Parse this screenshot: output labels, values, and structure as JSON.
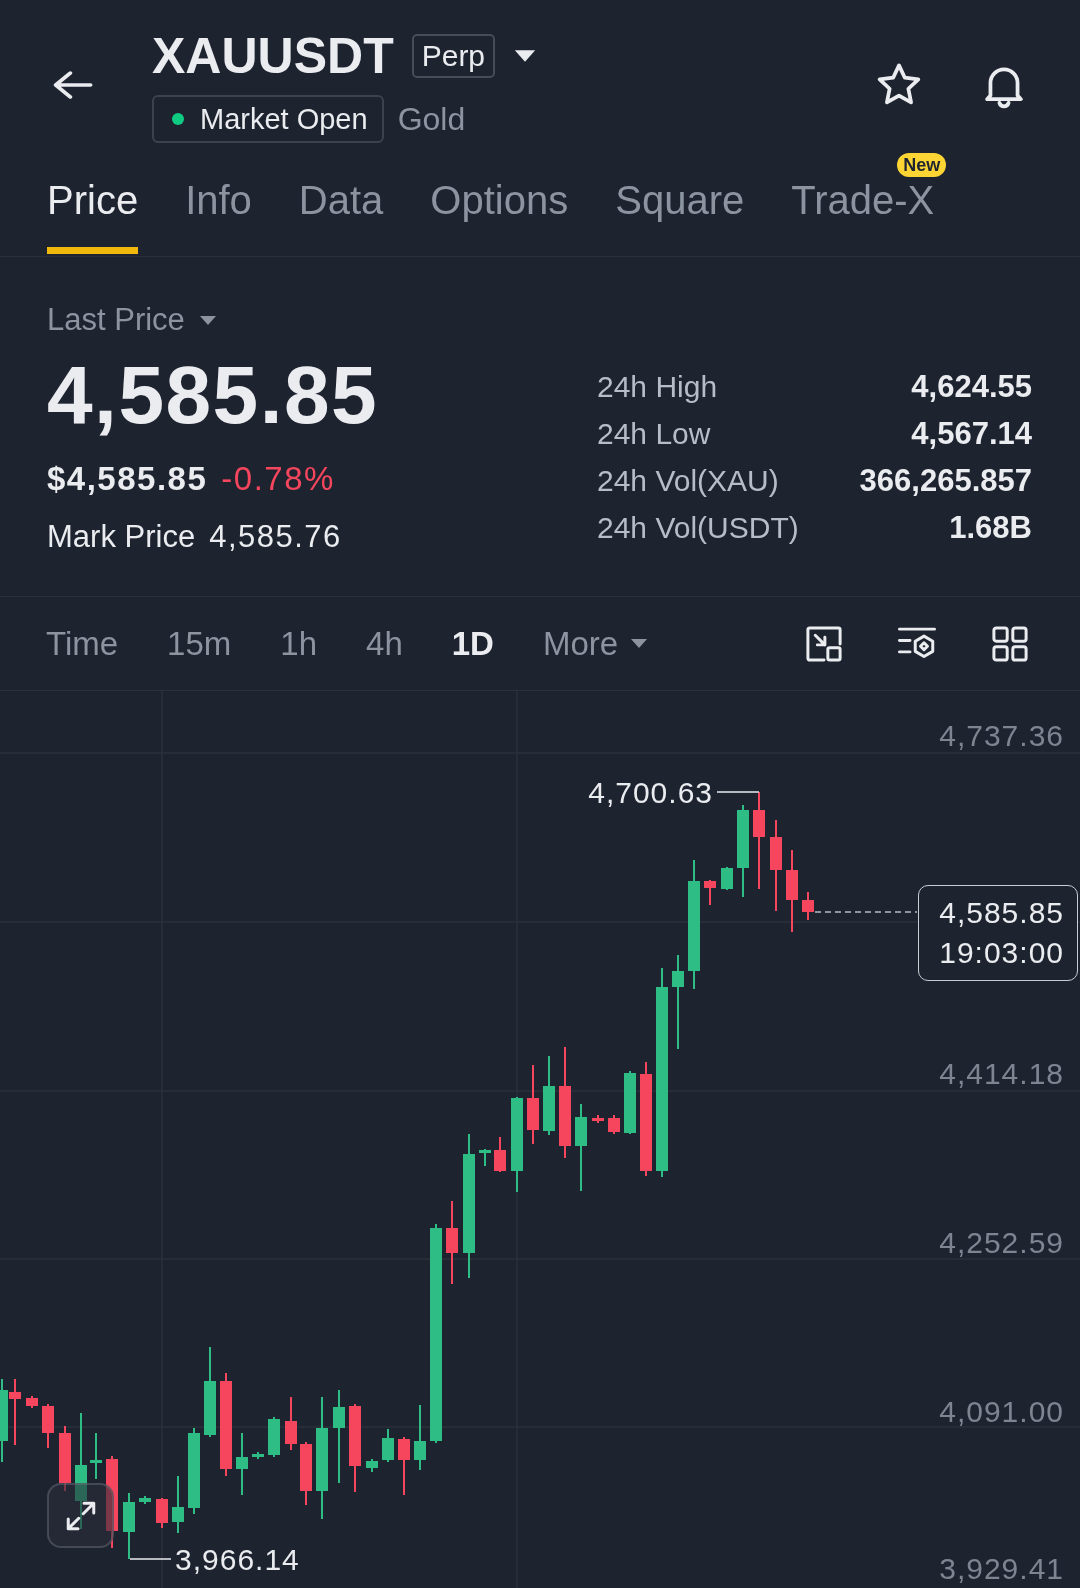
{
  "header": {
    "title": "XAUUSDT",
    "contract_badge": "Perp",
    "status": {
      "label": "Market Open",
      "color": "#0ecb81"
    },
    "subtitle": "Gold"
  },
  "tabs": [
    {
      "label": "Price",
      "selected": true
    },
    {
      "label": "Info",
      "selected": false
    },
    {
      "label": "Data",
      "selected": false
    },
    {
      "label": "Options",
      "selected": false
    },
    {
      "label": "Square",
      "selected": false
    },
    {
      "label": "Trade-X",
      "selected": false,
      "badge": "New"
    }
  ],
  "price_panel": {
    "price_type": "Last Price",
    "last_price": "4,585.85",
    "usd_price": "$4,585.85",
    "change": "-0.78%",
    "falling": true,
    "mark_price_label": "Mark Price",
    "mark_price": "4,585.76",
    "stats": [
      {
        "label": "24h High",
        "value": "4,624.55"
      },
      {
        "label": "24h Low",
        "value": "4,567.14"
      },
      {
        "label": "24h Vol(XAU)",
        "value": "366,265.857"
      },
      {
        "label": "24h Vol(USDT)",
        "value": "1.68B"
      }
    ]
  },
  "intervals": [
    {
      "label": "Time",
      "kind": "option",
      "selected": false
    },
    {
      "label": "15m",
      "kind": "option",
      "selected": false
    },
    {
      "label": "1h",
      "kind": "option",
      "selected": false
    },
    {
      "label": "4h",
      "kind": "option",
      "selected": false
    },
    {
      "label": "1D",
      "kind": "option",
      "selected": true
    },
    {
      "label": "More",
      "kind": "menu",
      "selected": false
    }
  ],
  "chart": {
    "price_axis": [
      "4,737.36",
      "4,414.18",
      "4,252.59",
      "4,091.00",
      "3,929.41"
    ],
    "high_label": "4,700.63",
    "low_label": "3,966.14",
    "last_price": "4,585.85",
    "countdown": "19:03:00"
  }
}
